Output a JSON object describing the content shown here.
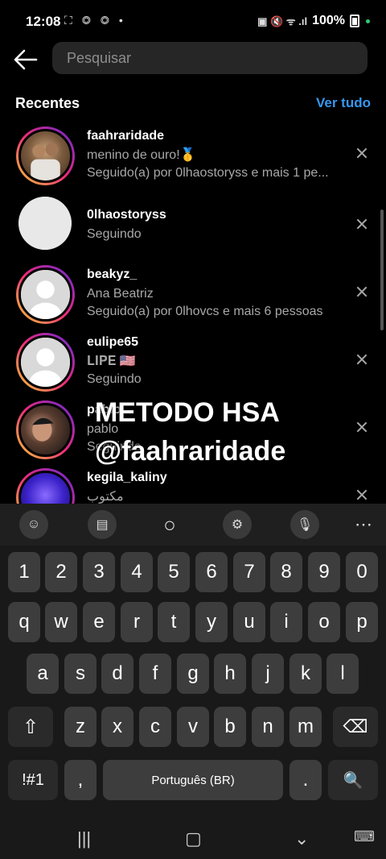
{
  "status": {
    "time": "12:08",
    "battery": "100%",
    "left_icons": "⛶ ◎ ◎ •",
    "right_icons": "▣ 🔇 ᯤ .ıl"
  },
  "search": {
    "placeholder": "Pesquisar",
    "value": ""
  },
  "recent": {
    "title": "Recentes",
    "see_all": "Ver tudo"
  },
  "items": [
    {
      "username": "faahraridade",
      "line1": "menino de ouro!🥇",
      "line2": "Seguido(a) por 0lhaostoryss e mais 1 pe...",
      "ring": true,
      "avatar": "photo-brown"
    },
    {
      "username": "0lhaostoryss",
      "line1": "Seguindo",
      "line2": "",
      "ring": false,
      "avatar": "default"
    },
    {
      "username": "beakyz_",
      "line1": "Ana Beatriz",
      "line2": "Seguido(a) por 0lhovcs e mais 6 pessoas",
      "ring": true,
      "avatar": "default"
    },
    {
      "username": "eulipe65",
      "line1": "𝐋𝐈𝐏𝐄 🇺🇸",
      "line2": "Seguindo",
      "ring": true,
      "avatar": "default"
    },
    {
      "username": "pablo",
      "line1": "pablo",
      "line2": "Seguindo",
      "ring": true,
      "avatar": "photo-dark"
    },
    {
      "username": "kegila_kaliny",
      "line1": "مكتوب",
      "line2": "",
      "ring": true,
      "avatar": "photo-blue"
    }
  ],
  "overlay": {
    "line1": "METODO HSA",
    "line2": "@faahraridade"
  },
  "keyboard": {
    "toolbar": [
      "☺",
      "▤",
      "○",
      "⚙",
      "🎙",
      "⋯"
    ],
    "numbers": [
      "1",
      "2",
      "3",
      "4",
      "5",
      "6",
      "7",
      "8",
      "9",
      "0"
    ],
    "row1": [
      "q",
      "w",
      "e",
      "r",
      "t",
      "y",
      "u",
      "i",
      "o",
      "p"
    ],
    "row2": [
      "a",
      "s",
      "d",
      "f",
      "g",
      "h",
      "j",
      "k",
      "l"
    ],
    "row3": [
      "z",
      "x",
      "c",
      "v",
      "b",
      "n",
      "m"
    ],
    "shift": "⇧",
    "backspace": "⌫",
    "symbols": "!#1",
    "comma": ",",
    "space": "Português (BR)",
    "period": ".",
    "search": "🔍"
  },
  "nav": {
    "recents": "|||",
    "home": "▢",
    "back": "⌄",
    "keyboard": "⌨"
  }
}
